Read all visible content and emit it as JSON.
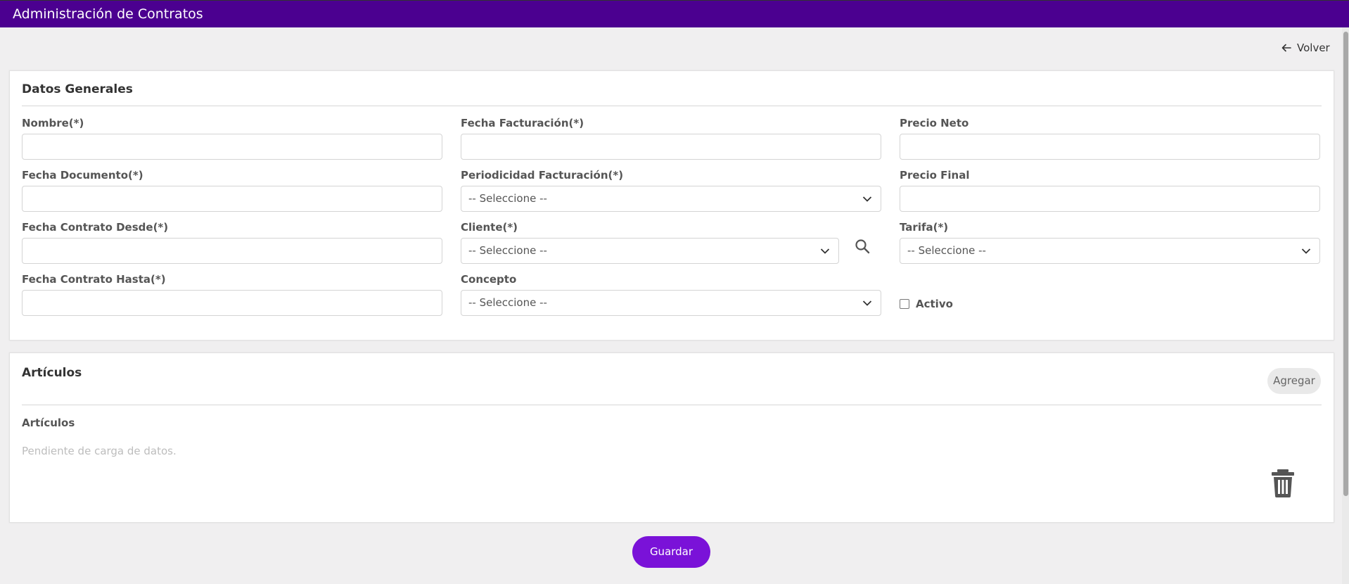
{
  "header": {
    "title": "Administración de Contratos"
  },
  "nav": {
    "back_label": "Volver"
  },
  "general": {
    "title": "Datos Generales",
    "nombre_label": "Nombre(*)",
    "fecha_documento_label": "Fecha Documento(*)",
    "fecha_desde_label": "Fecha Contrato Desde(*)",
    "fecha_hasta_label": "Fecha Contrato Hasta(*)",
    "fecha_facturacion_label": "Fecha Facturación(*)",
    "periodicidad_label": "Periodicidad Facturación(*)",
    "periodicidad_value": "-- Seleccione --",
    "cliente_label": "Cliente(*)",
    "cliente_value": "-- Seleccione --",
    "concepto_label": "Concepto",
    "concepto_value": "-- Seleccione --",
    "precio_neto_label": "Precio Neto",
    "precio_final_label": "Precio Final",
    "tarifa_label": "Tarifa(*)",
    "tarifa_value": "-- Seleccione --",
    "activo_label": "Activo",
    "activo_checked": false
  },
  "articulos": {
    "title": "Artículos",
    "add_label": "Agregar",
    "sub_label": "Artículos",
    "empty_text": "Pendiente de carga de datos."
  },
  "footer": {
    "save_label": "Guardar"
  },
  "colors": {
    "header_bg": "#4b0090",
    "primary": "#7a12d8"
  },
  "icons": [
    "arrow-left-icon",
    "chevron-down-icon",
    "search-icon",
    "trash-icon"
  ]
}
